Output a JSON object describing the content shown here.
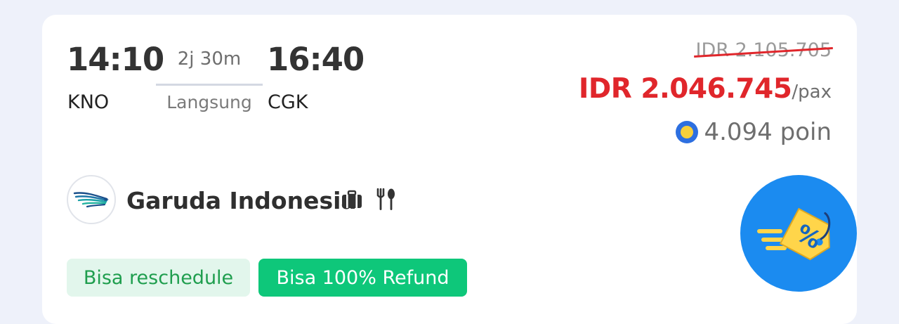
{
  "flight": {
    "depart_time": "14:10",
    "arrive_time": "16:40",
    "depart_code": "KNO",
    "arrive_code": "CGK",
    "duration": "2j 30m",
    "stops": "Langsung"
  },
  "price": {
    "original": "IDR 2.105.705",
    "current": "IDR 2.046.745",
    "per": "/pax",
    "points": "4.094 poin"
  },
  "airline": {
    "name": "Garuda Indonesia",
    "amenities": [
      "baggage-icon",
      "meal-icon"
    ]
  },
  "badges": {
    "reschedule": "Bisa reschedule",
    "refund": "Bisa 100% Refund"
  },
  "colors": {
    "price_red": "#e0262b",
    "refund_green": "#0ec77a",
    "reschedule_bg": "#e2f6ec",
    "promo_blue": "#1b8bf0"
  }
}
